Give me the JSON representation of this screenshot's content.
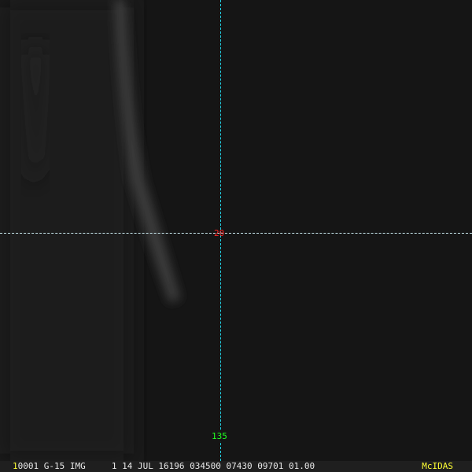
{
  "overlay": {
    "latitude_label": "20",
    "longitude_label": "135"
  },
  "statusbar": {
    "frame_number": "1",
    "info": "0001 G-15 IMG     1 14 JUL 16196 034500 07430 09701 01.00",
    "brand": "McIDAS"
  },
  "colors": {
    "background": "#151515",
    "grid_vertical": "#22d3e6",
    "lat_label": "#ff2020",
    "lon_label": "#20ff20",
    "brand": "#ffff33"
  }
}
